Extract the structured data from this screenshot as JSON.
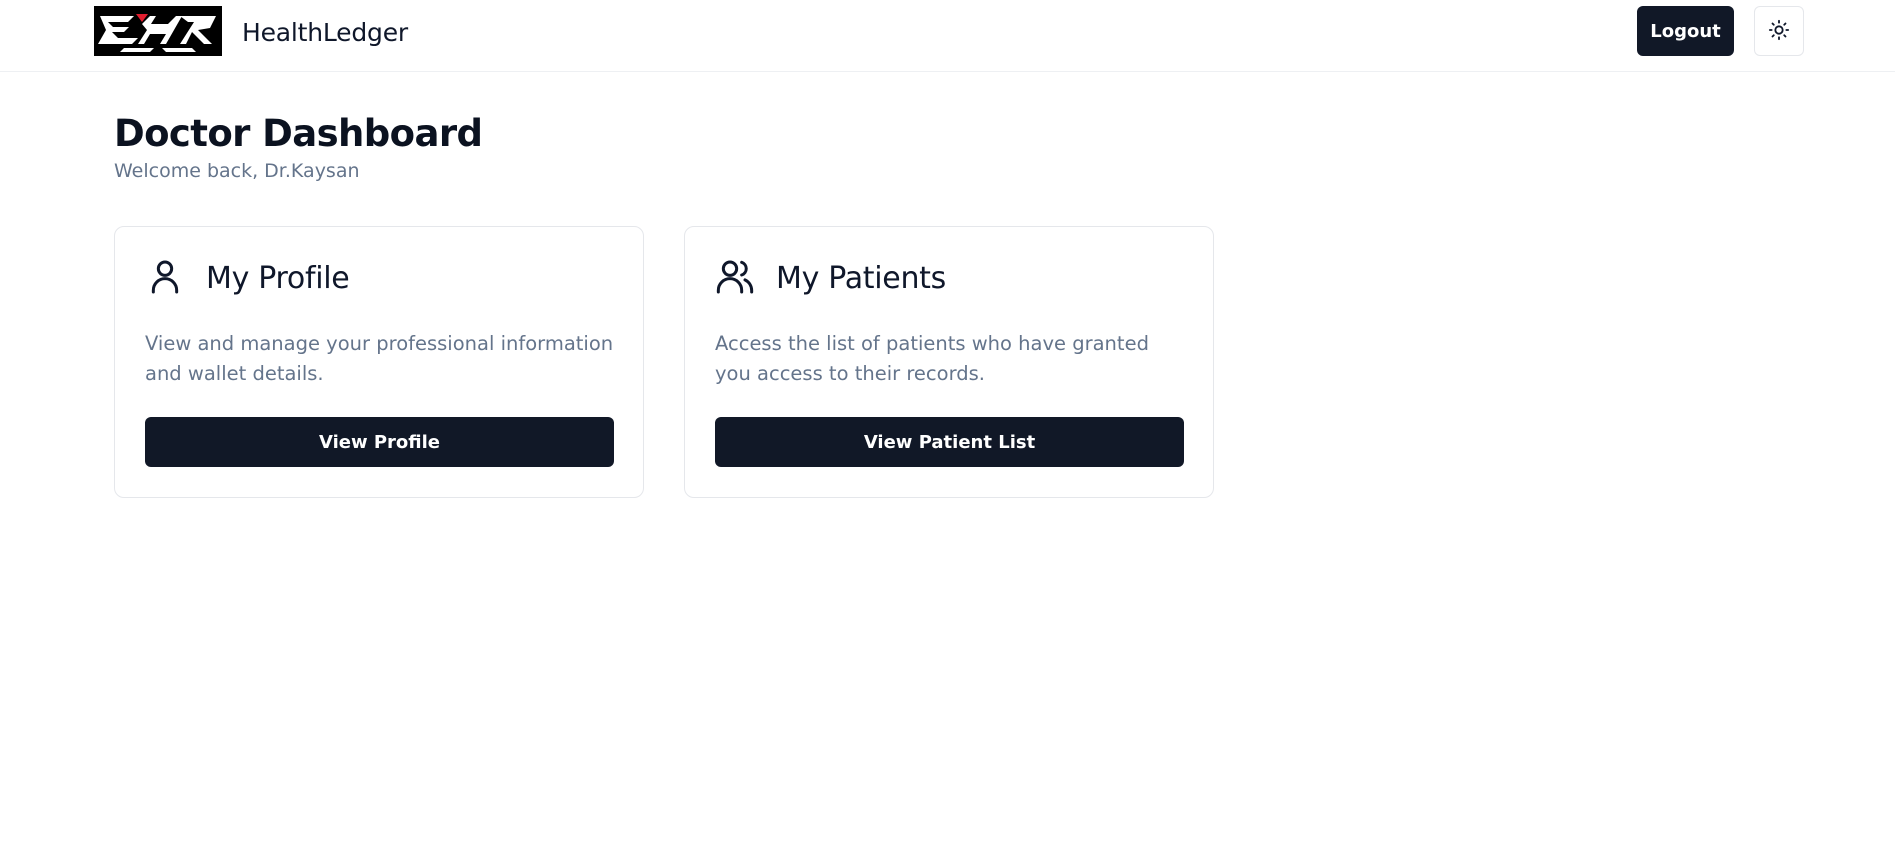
{
  "header": {
    "logo_text": "EHR",
    "brand": "HealthLedger",
    "logout_label": "Logout",
    "theme_toggle_icon": "sun-icon"
  },
  "dashboard": {
    "title": "Doctor Dashboard",
    "subtitle": "Welcome back, Dr.Kaysan"
  },
  "cards": [
    {
      "icon": "user-icon",
      "title": "My Profile",
      "description": "View and manage your professional information and wallet details.",
      "button_label": "View Profile"
    },
    {
      "icon": "users-icon",
      "title": "My Patients",
      "description": "Access the list of patients who have granted you access to their records.",
      "button_label": "View Patient List"
    }
  ],
  "colors": {
    "primary_button": "#111827",
    "muted_text": "#64748b",
    "border": "#e5e7eb",
    "logo_accent": "#e11d2e"
  }
}
